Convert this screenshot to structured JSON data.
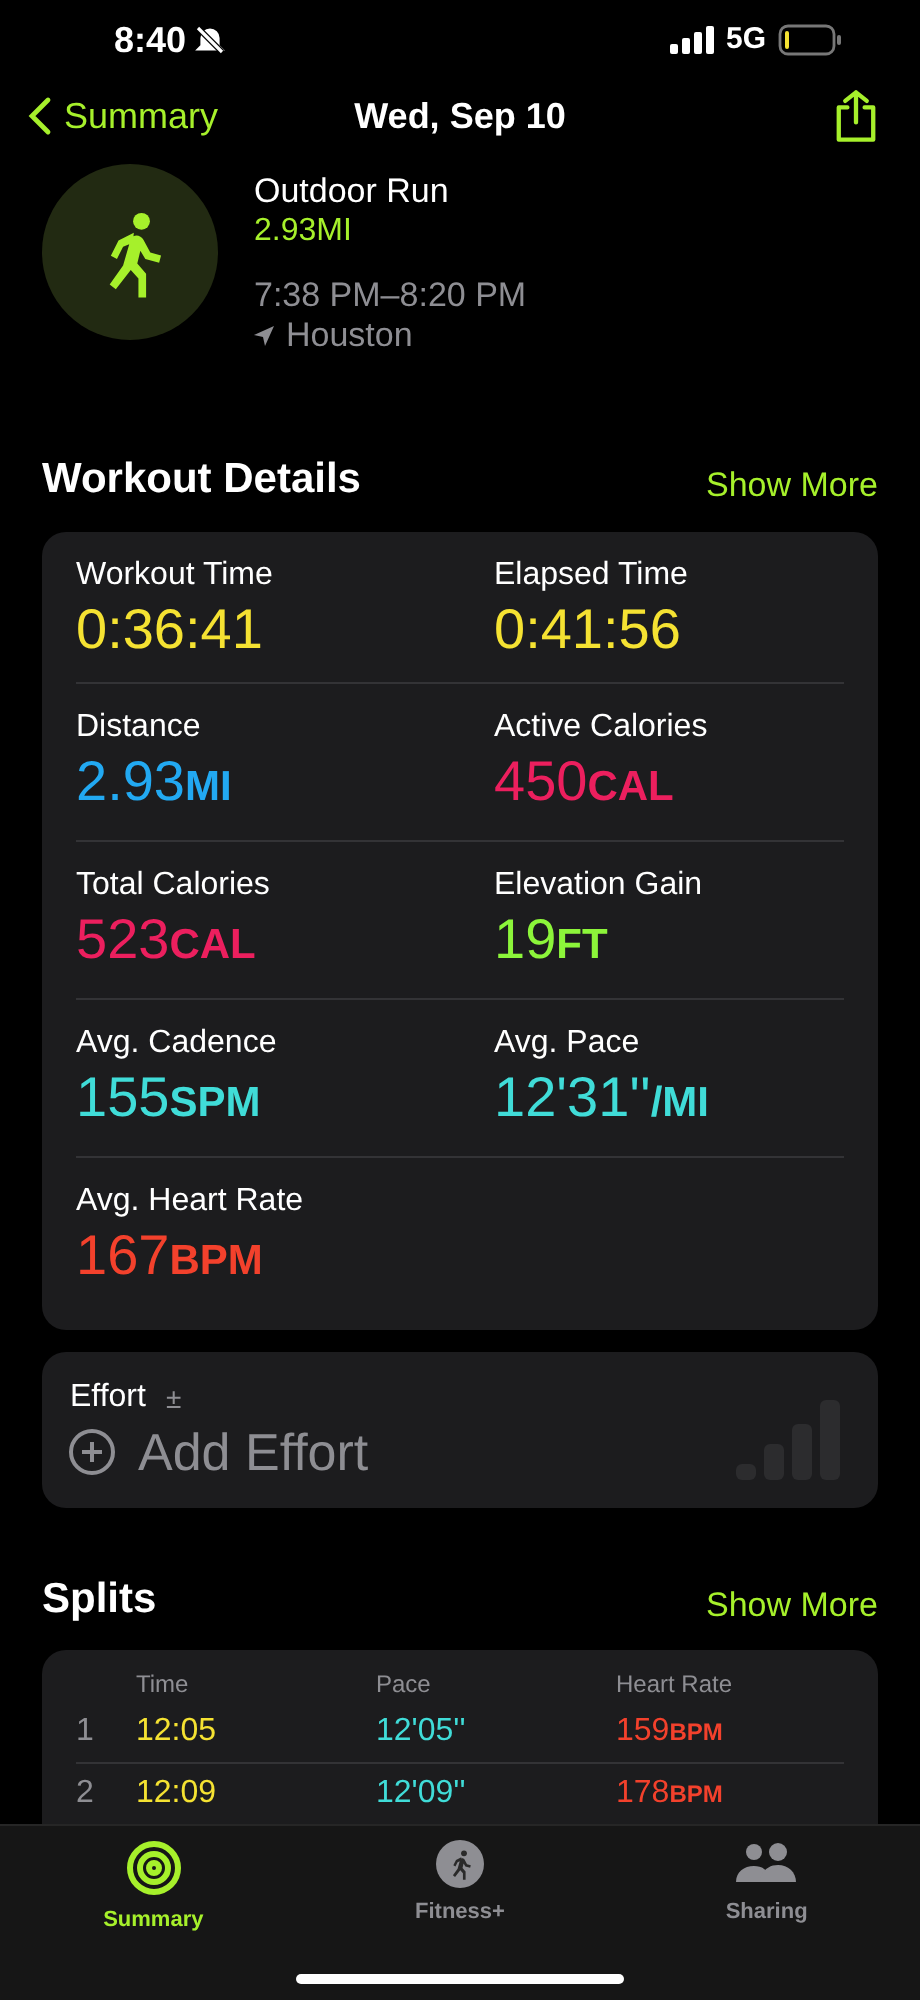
{
  "status_bar": {
    "time": "8:40",
    "network": "5G"
  },
  "nav": {
    "back": "Summary",
    "title": "Wed, Sep 10"
  },
  "workout": {
    "name": "Outdoor Run",
    "distance": "2.93MI",
    "time_range": "7:38 PM–8:20 PM",
    "location": "Houston"
  },
  "details": {
    "title": "Workout Details",
    "show_more": "Show More",
    "metrics": [
      {
        "label": "Workout Time",
        "value": "0:36:41",
        "color": "#f5e232"
      },
      {
        "label": "Elapsed Time",
        "value": "0:41:56",
        "color": "#f5e232"
      },
      {
        "label": "Distance",
        "value": "2.93",
        "unit": "MI",
        "color": "#22a9f2"
      },
      {
        "label": "Active Calories",
        "value": "450",
        "unit": "CAL",
        "color": "#ec1f5e"
      },
      {
        "label": "Total Calories",
        "value": "523",
        "unit": "CAL",
        "color": "#ec1f5e"
      },
      {
        "label": "Elevation Gain",
        "value": "19",
        "unit": "FT",
        "color": "#8cf53a"
      },
      {
        "label": "Avg. Cadence",
        "value": "155",
        "unit": "SPM",
        "color": "#40dcd8"
      },
      {
        "label": "Avg. Pace",
        "value": "12'31''",
        "unit": "/MI",
        "color": "#40dcd8"
      },
      {
        "label": "Avg. Heart Rate",
        "value": "167",
        "unit": "BPM",
        "color": "#f3412c"
      }
    ]
  },
  "effort": {
    "label": "Effort",
    "symbol": "±",
    "action": "Add Effort"
  },
  "splits": {
    "title": "Splits",
    "show_more": "Show More",
    "columns": [
      "Time",
      "Pace",
      "Heart Rate"
    ],
    "rows": [
      {
        "index": "1",
        "time": "12:05",
        "pace": "12'05''",
        "heart_rate": "159",
        "unit": "BPM"
      },
      {
        "index": "2",
        "time": "12:09",
        "pace": "12'09''",
        "heart_rate": "178",
        "unit": "BPM"
      }
    ]
  },
  "tab_bar": [
    {
      "label": "Summary",
      "kind": "rings",
      "selected": true
    },
    {
      "label": "Fitness+",
      "kind": "runner",
      "selected": false
    },
    {
      "label": "Sharing",
      "kind": "people",
      "selected": false
    }
  ]
}
